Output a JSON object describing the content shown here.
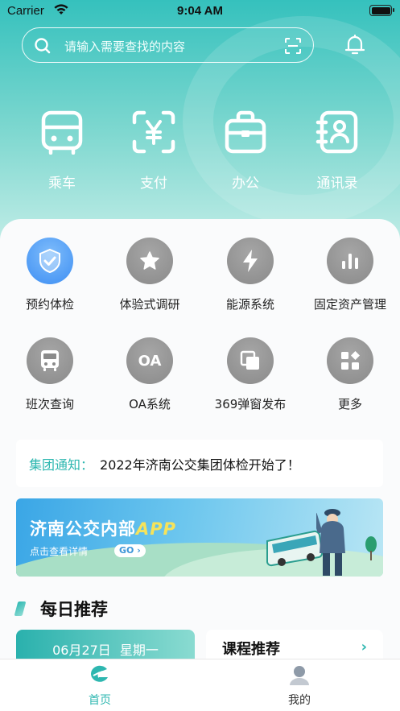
{
  "status_bar": {
    "carrier": "Carrier",
    "time": "9:04 AM"
  },
  "search": {
    "placeholder": "请输入需要查找的内容"
  },
  "quick_actions": [
    {
      "label": "乘车",
      "icon": "bus-front-icon"
    },
    {
      "label": "支付",
      "icon": "yuan-scan-icon"
    },
    {
      "label": "办公",
      "icon": "briefcase-icon"
    },
    {
      "label": "通讯录",
      "icon": "contact-card-icon"
    }
  ],
  "services": [
    {
      "label": "预约体检",
      "icon": "shield-check-icon",
      "color": "#3d8ef3"
    },
    {
      "label": "体验式调研",
      "icon": "star-icon",
      "color": "#8a8a8a"
    },
    {
      "label": "能源系统",
      "icon": "lightning-icon",
      "color": "#8a8a8a"
    },
    {
      "label": "固定资产管理",
      "icon": "bar-chart-icon",
      "color": "#8a8a8a"
    },
    {
      "label": "班次查询",
      "icon": "bus-icon",
      "color": "#8a8a8a"
    },
    {
      "label": "OA系统",
      "icon": "oa-text-icon",
      "icon_text": "OA",
      "color": "#8a8a8a"
    },
    {
      "label": "369弹窗发布",
      "icon": "layers-icon",
      "color": "#8a8a8a"
    },
    {
      "label": "更多",
      "icon": "grid-more-icon",
      "color": "#8a8a8a"
    }
  ],
  "notice": {
    "label": "集团通知：",
    "text": "2022年济南公交集团体检开始了！"
  },
  "banner": {
    "title": "济南公交内部",
    "title_highlight": "APP",
    "subtitle": "点击查看详情",
    "go_label": "GO"
  },
  "daily": {
    "title": "每日推荐",
    "date": "06月27日",
    "weekday": "星期一",
    "course_title": "课程推荐",
    "course_arrow": "›"
  },
  "tabs": [
    {
      "label": "首页",
      "active": true,
      "icon": "home-logo-icon",
      "color": "#2eb7b0"
    },
    {
      "label": "我的",
      "active": false,
      "icon": "user-icon",
      "color": "#333333"
    }
  ],
  "colors": {
    "accent": "#2eb7b0",
    "hero_top": "#35c1bd",
    "blue_service": "#3d8ef3",
    "grey_service": "#8a8a8a"
  }
}
